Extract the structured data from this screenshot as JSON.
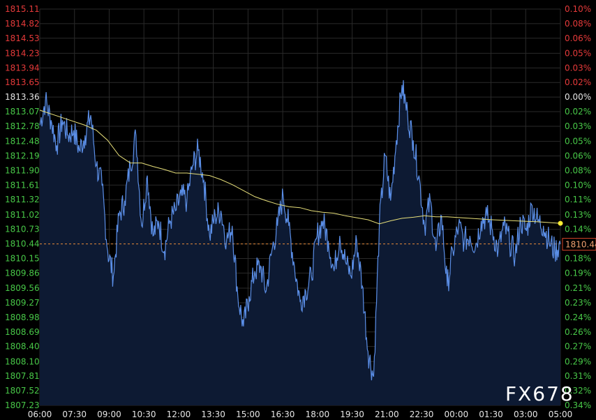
{
  "watermark": "FX678",
  "colors": {
    "background": "#000000",
    "grid": "#2a2a2a",
    "price_line": "#5b8fe8",
    "area_fill": "#0d1a33",
    "ma_line": "#e8e07a",
    "ma_dot": "#ffee33",
    "prev_close_line": "#e88a3a",
    "up_label": "#e53a3a",
    "down_label": "#48c848",
    "neutral_label": "#e6e6e6",
    "last_tag_bg": "#d9462b"
  },
  "chart_data": {
    "type": "line",
    "reference_price": 1813.36,
    "last_price_label": "1810.44",
    "x_ticks": [
      "06:00",
      "07:30",
      "09:00",
      "10:30",
      "12:00",
      "13:30",
      "15:00",
      "16:30",
      "18:00",
      "19:30",
      "21:00",
      "22:30",
      "00:00",
      "01:30",
      "03:00",
      "05:00"
    ],
    "y_left_ticks": [
      "1815.11",
      "1814.82",
      "1814.53",
      "1814.23",
      "1813.94",
      "1813.65",
      "1813.36",
      "1813.07",
      "1812.78",
      "1812.48",
      "1812.19",
      "1811.90",
      "1811.61",
      "1811.32",
      "1811.02",
      "1810.73",
      "1810.44",
      "1810.15",
      "1809.86",
      "1809.56",
      "1809.27",
      "1808.98",
      "1808.69",
      "1808.40",
      "1808.10",
      "1807.81",
      "1807.52",
      "1807.23"
    ],
    "y_right_ticks": [
      "0.10%",
      "0.08%",
      "0.06%",
      "0.05%",
      "0.03%",
      "0.02%",
      "0.00%",
      "0.02%",
      "0.03%",
      "0.05%",
      "0.06%",
      "0.08%",
      "0.10%",
      "0.11%",
      "0.13%",
      "0.14%",
      "0.16%",
      "0.18%",
      "0.19%",
      "0.21%",
      "0.23%",
      "0.24%",
      "0.26%",
      "0.27%",
      "0.29%",
      "0.31%",
      "0.32%",
      "0.34%"
    ],
    "ylim": [
      1807.23,
      1815.11
    ],
    "series": [
      {
        "kind": "price",
        "points": [
          [
            "06:00",
            1812.8
          ],
          [
            "06:15",
            1813.3
          ],
          [
            "06:30",
            1812.9
          ],
          [
            "06:45",
            1812.4
          ],
          [
            "07:00",
            1812.9
          ],
          [
            "07:15",
            1812.6
          ],
          [
            "07:30",
            1812.7
          ],
          [
            "07:45",
            1812.3
          ],
          [
            "08:00",
            1812.6
          ],
          [
            "08:15",
            1813.0
          ],
          [
            "08:30",
            1812.0
          ],
          [
            "08:45",
            1811.6
          ],
          [
            "09:00",
            1810.3
          ],
          [
            "09:15",
            1809.8
          ],
          [
            "09:30",
            1811.0
          ],
          [
            "09:45",
            1811.3
          ],
          [
            "10:00",
            1812.0
          ],
          [
            "10:15",
            1812.6
          ],
          [
            "10:30",
            1810.8
          ],
          [
            "10:45",
            1811.8
          ],
          [
            "11:00",
            1810.6
          ],
          [
            "11:15",
            1810.9
          ],
          [
            "11:30",
            1810.3
          ],
          [
            "11:45",
            1810.9
          ],
          [
            "12:00",
            1811.1
          ],
          [
            "12:15",
            1811.4
          ],
          [
            "12:30",
            1811.3
          ],
          [
            "12:45",
            1812.0
          ],
          [
            "13:00",
            1812.3
          ],
          [
            "13:15",
            1811.7
          ],
          [
            "13:30",
            1810.6
          ],
          [
            "13:45",
            1811.0
          ],
          [
            "14:00",
            1811.1
          ],
          [
            "14:15",
            1810.5
          ],
          [
            "14:30",
            1810.8
          ],
          [
            "14:45",
            1809.4
          ],
          [
            "15:00",
            1808.8
          ],
          [
            "15:15",
            1809.4
          ],
          [
            "15:30",
            1809.9
          ],
          [
            "15:45",
            1810.0
          ],
          [
            "16:00",
            1809.5
          ],
          [
            "16:15",
            1810.3
          ],
          [
            "16:30",
            1810.8
          ],
          [
            "16:45",
            1811.4
          ],
          [
            "17:00",
            1810.8
          ],
          [
            "17:15",
            1810.0
          ],
          [
            "17:30",
            1809.3
          ],
          [
            "17:45",
            1809.5
          ],
          [
            "18:00",
            1809.8
          ],
          [
            "18:15",
            1810.6
          ],
          [
            "18:30",
            1810.9
          ],
          [
            "18:45",
            1810.5
          ],
          [
            "19:00",
            1809.9
          ],
          [
            "19:15",
            1810.6
          ],
          [
            "19:30",
            1810.1
          ],
          [
            "19:45",
            1809.8
          ],
          [
            "20:00",
            1810.5
          ],
          [
            "20:15",
            1809.6
          ],
          [
            "20:30",
            1808.3
          ],
          [
            "20:45",
            1807.8
          ],
          [
            "21:00",
            1810.8
          ],
          [
            "21:15",
            1812.2
          ],
          [
            "21:30",
            1811.3
          ],
          [
            "21:45",
            1812.5
          ],
          [
            "22:00",
            1813.6
          ],
          [
            "22:15",
            1813.0
          ],
          [
            "22:30",
            1812.5
          ],
          [
            "22:45",
            1811.8
          ],
          [
            "23:00",
            1810.8
          ],
          [
            "23:15",
            1811.3
          ],
          [
            "23:30",
            1810.3
          ],
          [
            "23:45",
            1811.0
          ],
          [
            "00:00",
            1809.6
          ],
          [
            "00:15",
            1810.3
          ],
          [
            "00:30",
            1810.8
          ],
          [
            "00:45",
            1810.5
          ],
          [
            "01:00",
            1810.6
          ],
          [
            "01:15",
            1810.4
          ],
          [
            "01:30",
            1810.9
          ],
          [
            "01:45",
            1811.0
          ],
          [
            "02:00",
            1810.7
          ],
          [
            "02:15",
            1810.3
          ],
          [
            "02:30",
            1810.8
          ],
          [
            "02:45",
            1810.5
          ],
          [
            "03:00",
            1810.2
          ],
          [
            "03:15",
            1810.9
          ],
          [
            "03:30",
            1810.7
          ],
          [
            "03:45",
            1811.2
          ],
          [
            "04:00",
            1810.9
          ],
          [
            "04:15",
            1810.8
          ],
          [
            "04:30",
            1810.5
          ],
          [
            "04:45",
            1810.3
          ],
          [
            "05:00",
            1810.44
          ]
        ]
      },
      {
        "kind": "moving_average",
        "points": [
          [
            "06:00",
            1813.1
          ],
          [
            "07:00",
            1812.95
          ],
          [
            "08:00",
            1812.8
          ],
          [
            "08:30",
            1812.7
          ],
          [
            "09:00",
            1812.5
          ],
          [
            "09:30",
            1812.2
          ],
          [
            "10:00",
            1812.05
          ],
          [
            "10:30",
            1812.05
          ],
          [
            "11:00",
            1811.98
          ],
          [
            "11:30",
            1811.92
          ],
          [
            "12:00",
            1811.85
          ],
          [
            "12:30",
            1811.85
          ],
          [
            "13:30",
            1811.8
          ],
          [
            "14:00",
            1811.72
          ],
          [
            "14:30",
            1811.62
          ],
          [
            "15:00",
            1811.5
          ],
          [
            "15:30",
            1811.38
          ],
          [
            "16:00",
            1811.3
          ],
          [
            "16:30",
            1811.23
          ],
          [
            "17:00",
            1811.18
          ],
          [
            "17:30",
            1811.16
          ],
          [
            "18:00",
            1811.1
          ],
          [
            "18:30",
            1811.07
          ],
          [
            "19:00",
            1811.05
          ],
          [
            "19:30",
            1811.0
          ],
          [
            "20:00",
            1810.96
          ],
          [
            "20:30",
            1810.92
          ],
          [
            "21:00",
            1810.84
          ],
          [
            "21:30",
            1810.9
          ],
          [
            "22:00",
            1810.95
          ],
          [
            "22:30",
            1810.97
          ],
          [
            "23:00",
            1811.0
          ],
          [
            "23:30",
            1810.98
          ],
          [
            "00:00",
            1810.98
          ],
          [
            "01:00",
            1810.95
          ],
          [
            "02:00",
            1810.92
          ],
          [
            "03:00",
            1810.9
          ],
          [
            "04:00",
            1810.88
          ],
          [
            "05:00",
            1810.85
          ]
        ]
      }
    ]
  }
}
